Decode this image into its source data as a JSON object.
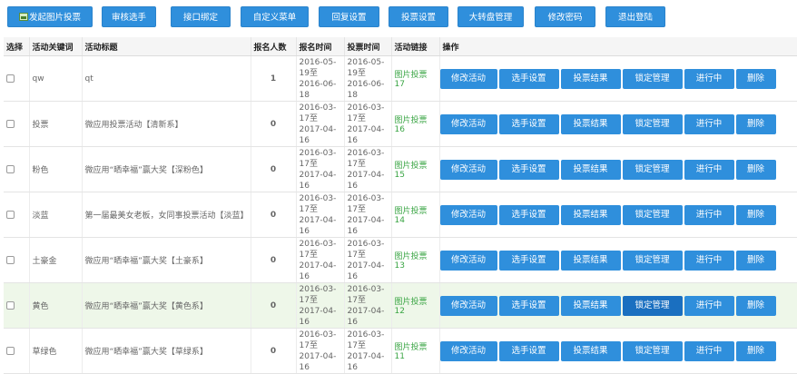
{
  "toolbar": {
    "start_vote": "发起图片投票",
    "review_players": "审核选手",
    "interface_binding": "接口绑定",
    "custom_menu": "自定义菜单",
    "reply_settings": "回复设置",
    "vote_settings": "投票设置",
    "wheel_management": "大转盘管理",
    "change_password": "修改密码",
    "logout": "退出登陆"
  },
  "table": {
    "headers": [
      "选择",
      "活动关键词",
      "活动标题",
      "报名人数",
      "报名时间",
      "投票时间",
      "活动链接",
      "操作"
    ],
    "rows": [
      {
        "keyword": "qw",
        "title": "qt",
        "count": "1",
        "signup": "2016-05-19至2016-06-18",
        "vote": "2016-05-19至2016-06-18",
        "link": "图片投票17"
      },
      {
        "keyword": "投票",
        "title": "微应用投票活动【清新系】",
        "count": "0",
        "signup": "2016-03-17至2017-04-16",
        "vote": "2016-03-17至2017-04-16",
        "link": "图片投票16"
      },
      {
        "keyword": "粉色",
        "title": "微应用“晒幸福”赢大奖【深粉色】",
        "count": "0",
        "signup": "2016-03-17至2017-04-16",
        "vote": "2016-03-17至2017-04-16",
        "link": "图片投票15"
      },
      {
        "keyword": "淡蓝",
        "title": "第一届最美女老板，女同事投票活动【淡蓝】",
        "count": "0",
        "signup": "2016-03-17至2017-04-16",
        "vote": "2016-03-17至2017-04-16",
        "link": "图片投票14"
      },
      {
        "keyword": "土豪金",
        "title": "微应用“晒幸福”赢大奖【土豪系】",
        "count": "0",
        "signup": "2016-03-17至2017-04-16",
        "vote": "2016-03-17至2017-04-16",
        "link": "图片投票13"
      },
      {
        "keyword": "黄色",
        "title": "微应用“晒幸福”赢大奖【黄色系】",
        "count": "0",
        "signup": "2016-03-17至2017-04-16",
        "vote": "2016-03-17至2017-04-16",
        "link": "图片投票12"
      },
      {
        "keyword": "草绿色",
        "title": "微应用“晒幸福”赢大奖【草绿系】",
        "count": "0",
        "signup": "2016-03-17至2017-04-16",
        "vote": "2016-03-17至2017-04-16",
        "link": "图片投票11"
      }
    ],
    "actions": [
      "修改活动",
      "选手设置",
      "投票结果",
      "锁定管理",
      "进行中",
      "删除"
    ]
  },
  "colors": {
    "button_blue": "#2f8fdc",
    "button_pressed": "#1a6fc0",
    "link_green": "#3aa544",
    "row_highlight": "#eef7e9"
  },
  "icons": {
    "start_vote": "picture-icon"
  }
}
